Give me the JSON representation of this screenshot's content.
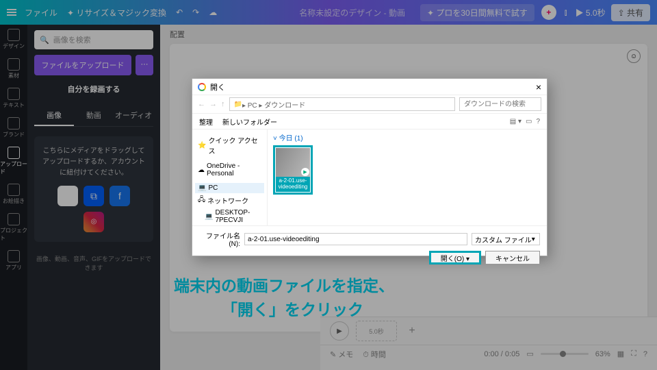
{
  "topbar": {
    "file": "ファイル",
    "resize": "リサイズ＆マジック変換",
    "doc_title": "名称未設定のデザイン - 動画",
    "trial": "プロを30日間無料で試す",
    "duration": "5.0秒",
    "share": "共有"
  },
  "leftnav": [
    "デザイン",
    "素材",
    "テキスト",
    "ブランド",
    "アップロード",
    "お絵描き",
    "プロジェクト",
    "アプリ"
  ],
  "leftnav_active": 4,
  "panel": {
    "search_placeholder": "画像を検索",
    "upload": "ファイルをアップロード",
    "record": "自分を録画する",
    "tabs": [
      "画像",
      "動画",
      "オーディオ"
    ],
    "drag_text": "こちらにメディアをドラッグしてアップロードするか、アカウントに紐付けてください。",
    "note": "画像、動画、音声、GIFをアップロードできます"
  },
  "canvas": {
    "label": "配置"
  },
  "dialog": {
    "title": "開く",
    "path_icon": "▸ PC ▸ ダウンロード",
    "search_placeholder": "ダウンロードの検索",
    "organize": "整理",
    "new_folder": "新しいフォルダー",
    "tree": [
      "クイック アクセス",
      "OneDrive - Personal",
      "PC",
      "ネットワーク",
      "DESKTOP-7PECVJI"
    ],
    "tree_selected": 2,
    "group": "今日 (1)",
    "file_name": "a-2-01.use-videoediting",
    "filename_label": "ファイル名(N):",
    "filename_value": "a-2-01.use-videoediting",
    "filter": "カスタム ファイル",
    "open": "開く(O)",
    "cancel": "キャンセル"
  },
  "caption": {
    "l1": "端末内の動画ファイルを指定、",
    "l2": "「開く」をクリック"
  },
  "timeline": {
    "clip": "5.0秒",
    "memo": "メモ",
    "time_label": "時間",
    "time": "0:00 / 0:05",
    "zoom": "63%"
  }
}
